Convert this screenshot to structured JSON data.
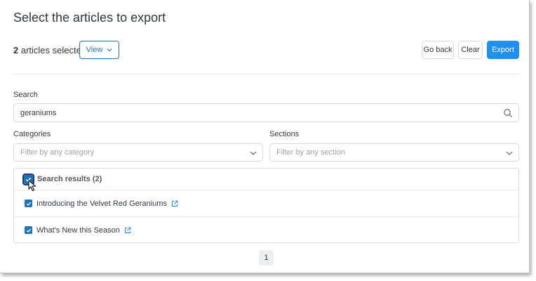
{
  "dialog": {
    "title": "Select the articles to export",
    "selected_count": "2",
    "selected_suffix": "articles selected",
    "view_label": "View",
    "go_back_label": "Go back",
    "clear_label": "Clear",
    "export_label": "Export"
  },
  "search": {
    "label": "Search",
    "value": "geraniums"
  },
  "categories": {
    "label": "Categories",
    "placeholder": "Filter by any category"
  },
  "sections": {
    "label": "Sections",
    "placeholder": "Filter by any section"
  },
  "results": {
    "header": "Search results (2)",
    "items": [
      {
        "title": "Introducing the Velvet Red Geraniums",
        "checked": true
      },
      {
        "title": "What's New this Season",
        "checked": true
      }
    ]
  },
  "pagination": {
    "current_page": "1"
  },
  "colors": {
    "accent": "#1f73b7",
    "primary_button": "#1f8ff0"
  }
}
